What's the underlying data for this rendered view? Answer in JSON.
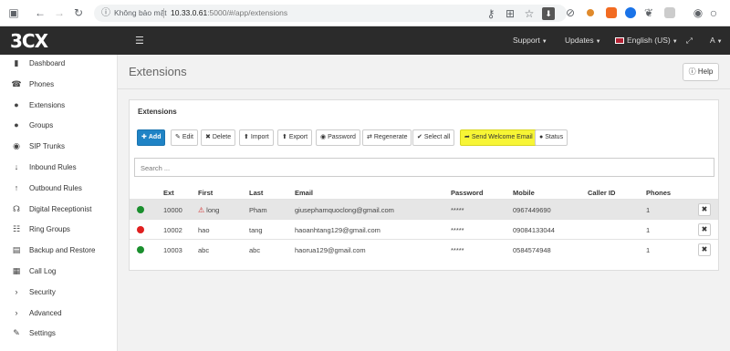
{
  "browser": {
    "security_label": "Không bảo mật",
    "url_host": "10.33.0.61",
    "url_rest": ":5000/#/app/extensions",
    "avatar_label": "A"
  },
  "header": {
    "logo_part1": "3",
    "logo_part2": "CX",
    "menu_support": "Support",
    "menu_updates": "Updates",
    "menu_language": "English (US)",
    "menu_user": "A"
  },
  "sidebar": {
    "items": [
      {
        "label": "Dashboard",
        "icon": "bar-chart-icon",
        "glyph": "▮"
      },
      {
        "label": "Phones",
        "icon": "phone-icon",
        "glyph": "☎"
      },
      {
        "label": "Extensions",
        "icon": "user-icon",
        "glyph": "●"
      },
      {
        "label": "Groups",
        "icon": "users-icon",
        "glyph": "●"
      },
      {
        "label": "SIP Trunks",
        "icon": "globe-icon",
        "glyph": "◉"
      },
      {
        "label": "Inbound Rules",
        "icon": "arrow-down-icon",
        "glyph": "↓"
      },
      {
        "label": "Outbound Rules",
        "icon": "arrow-up-icon",
        "glyph": "↑"
      },
      {
        "label": "Digital Receptionist",
        "icon": "headset-icon",
        "glyph": "☊"
      },
      {
        "label": "Ring Groups",
        "icon": "ring-group-icon",
        "glyph": "☷"
      },
      {
        "label": "Backup and Restore",
        "icon": "server-icon",
        "glyph": "▤"
      },
      {
        "label": "Call Log",
        "icon": "log-icon",
        "glyph": "▦"
      },
      {
        "label": "Security",
        "icon": "chevron-right-icon",
        "glyph": "›"
      },
      {
        "label": "Advanced",
        "icon": "chevron-right-icon",
        "glyph": "›"
      },
      {
        "label": "Settings",
        "icon": "wrench-icon",
        "glyph": "✎"
      }
    ]
  },
  "main": {
    "title": "Extensions",
    "help_label": "Help",
    "panel_title": "Extensions",
    "search_placeholder": "Search ...",
    "toolbar": {
      "add": "Add",
      "edit": "Edit",
      "delete": "Delete",
      "import": "Import",
      "export": "Export",
      "password": "Password",
      "regenerate": "Regenerate",
      "select_all": "Select all",
      "send_welcome": "Send Welcome Email",
      "status": "Status"
    },
    "columns": [
      "Ext",
      "First",
      "Last",
      "Email",
      "Password",
      "Mobile",
      "Caller ID",
      "Phones"
    ],
    "rows": [
      {
        "status": "green",
        "ext": "10000",
        "first": "long",
        "warning": true,
        "last": "Pham",
        "email": "giusephamquoclong@gmail.com",
        "password": "*****",
        "mobile": "0967449690",
        "caller_id": "",
        "phones": "1"
      },
      {
        "status": "red",
        "ext": "10002",
        "first": "hao",
        "warning": false,
        "last": "tang",
        "email": "haoanhtang129@gmail.com",
        "password": "*****",
        "mobile": "09084133044",
        "caller_id": "",
        "phones": "1"
      },
      {
        "status": "green",
        "ext": "10003",
        "first": "abc",
        "warning": false,
        "last": "abc",
        "email": "haorua129@gmail.com",
        "password": "*****",
        "mobile": "0584574948",
        "caller_id": "",
        "phones": "1"
      }
    ]
  },
  "colors": {
    "header_bg": "#2b2b2b",
    "primary": "#1f83c5",
    "highlight": "#f7f535",
    "status_green": "#1b8f2e",
    "status_red": "#e02020"
  }
}
